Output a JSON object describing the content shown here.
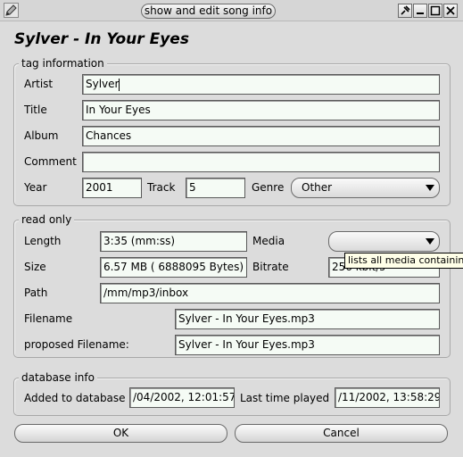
{
  "window": {
    "title": "show and edit song info",
    "buttons": {
      "pin": "✕",
      "min": "▁",
      "max": "□",
      "close": "✕"
    }
  },
  "heading": "Sylver - In Your Eyes",
  "tag_info": {
    "legend": "tag information",
    "artist_label": "Artist",
    "artist_value": "Sylver",
    "title_label": "Title",
    "title_value": "In Your Eyes",
    "album_label": "Album",
    "album_value": "Chances",
    "comment_label": "Comment",
    "comment_value": "",
    "year_label": "Year",
    "year_value": "2001",
    "track_label": "Track",
    "track_value": "5",
    "genre_label": "Genre",
    "genre_value": "Other"
  },
  "read_only": {
    "legend": "read only",
    "length_label": "Length",
    "length_value": "3:35 (mm:ss)",
    "media_label": "Media",
    "media_value": "",
    "size_label": "Size",
    "size_value": "6.57 MB (   6888095 Bytes)",
    "bitrate_label": "Bitrate",
    "bitrate_value": "256 kbit/s",
    "path_label": "Path",
    "path_value": "/mm/mp3/inbox",
    "filename_label": "Filename",
    "filename_value": "Sylver - In Your Eyes.mp3",
    "proposed_label": "proposed Filename:",
    "proposed_value": "Sylver - In Your Eyes.mp3",
    "tooltip": "lists all media containing this file"
  },
  "db_info": {
    "legend": "database info",
    "added_label": "Added to database",
    "added_value": "/04/2002, 12:01:57",
    "played_label": "Last time played",
    "played_value": "/11/2002, 13:58:29"
  },
  "actions": {
    "ok": "OK",
    "cancel": "Cancel"
  }
}
